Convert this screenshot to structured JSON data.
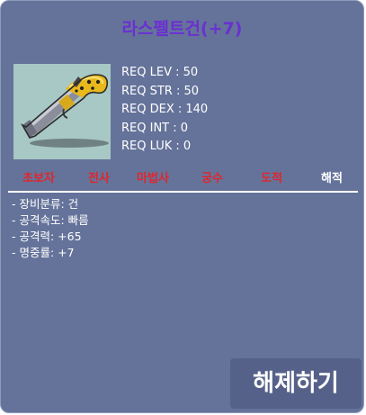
{
  "item": {
    "name": "라스펠트건(+7)",
    "icon": "pistol-icon"
  },
  "requirements": [
    "REQ LEV : 50",
    "REQ STR : 50",
    "REQ DEX : 140",
    "REQ INT : 0",
    "REQ LUK : 0"
  ],
  "jobs": [
    {
      "label": "초보자",
      "color": "#e0262d"
    },
    {
      "label": "전사",
      "color": "#e0262d"
    },
    {
      "label": "마법사",
      "color": "#e0262d"
    },
    {
      "label": "궁수",
      "color": "#e0262d"
    },
    {
      "label": "도적",
      "color": "#e0262d"
    },
    {
      "label": "해적",
      "color": "#ffffff"
    }
  ],
  "stats": [
    "- 장비분류: 건",
    "- 공격속도: 빠름",
    "- 공격력: +65",
    "- 명중률: +7"
  ],
  "action": {
    "label": "해제하기"
  },
  "colors": {
    "panel": "#65739a",
    "title": "#6b2fd2",
    "unavailable_job": "#e0262d",
    "available_job": "#ffffff",
    "button": "#56618a"
  }
}
